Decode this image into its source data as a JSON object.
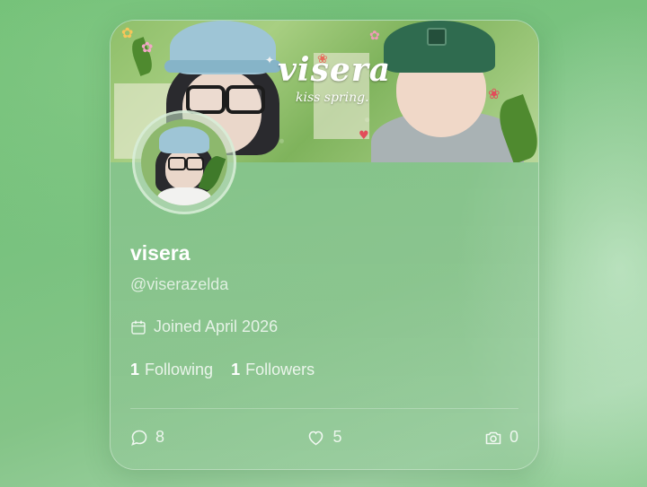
{
  "profile": {
    "display_name": "visera",
    "handle": "@viserazelda",
    "joined": "Joined April 2026",
    "following_count": "1",
    "following_label": "Following",
    "followers_count": "1",
    "followers_label": "Followers"
  },
  "banner": {
    "title": "visera",
    "subtitle": "kiss spring."
  },
  "actions": {
    "comments_count": "8",
    "likes_count": "5",
    "photos_count": "0"
  },
  "icons": {
    "joined": "calendar-icon",
    "comments": "comment-icon",
    "likes": "heart-icon",
    "photos": "camera-icon"
  },
  "colors": {
    "background": "#79c27f",
    "card": "#8fc693",
    "text": "#ffffff",
    "muted_text": "#e4f1e5"
  }
}
